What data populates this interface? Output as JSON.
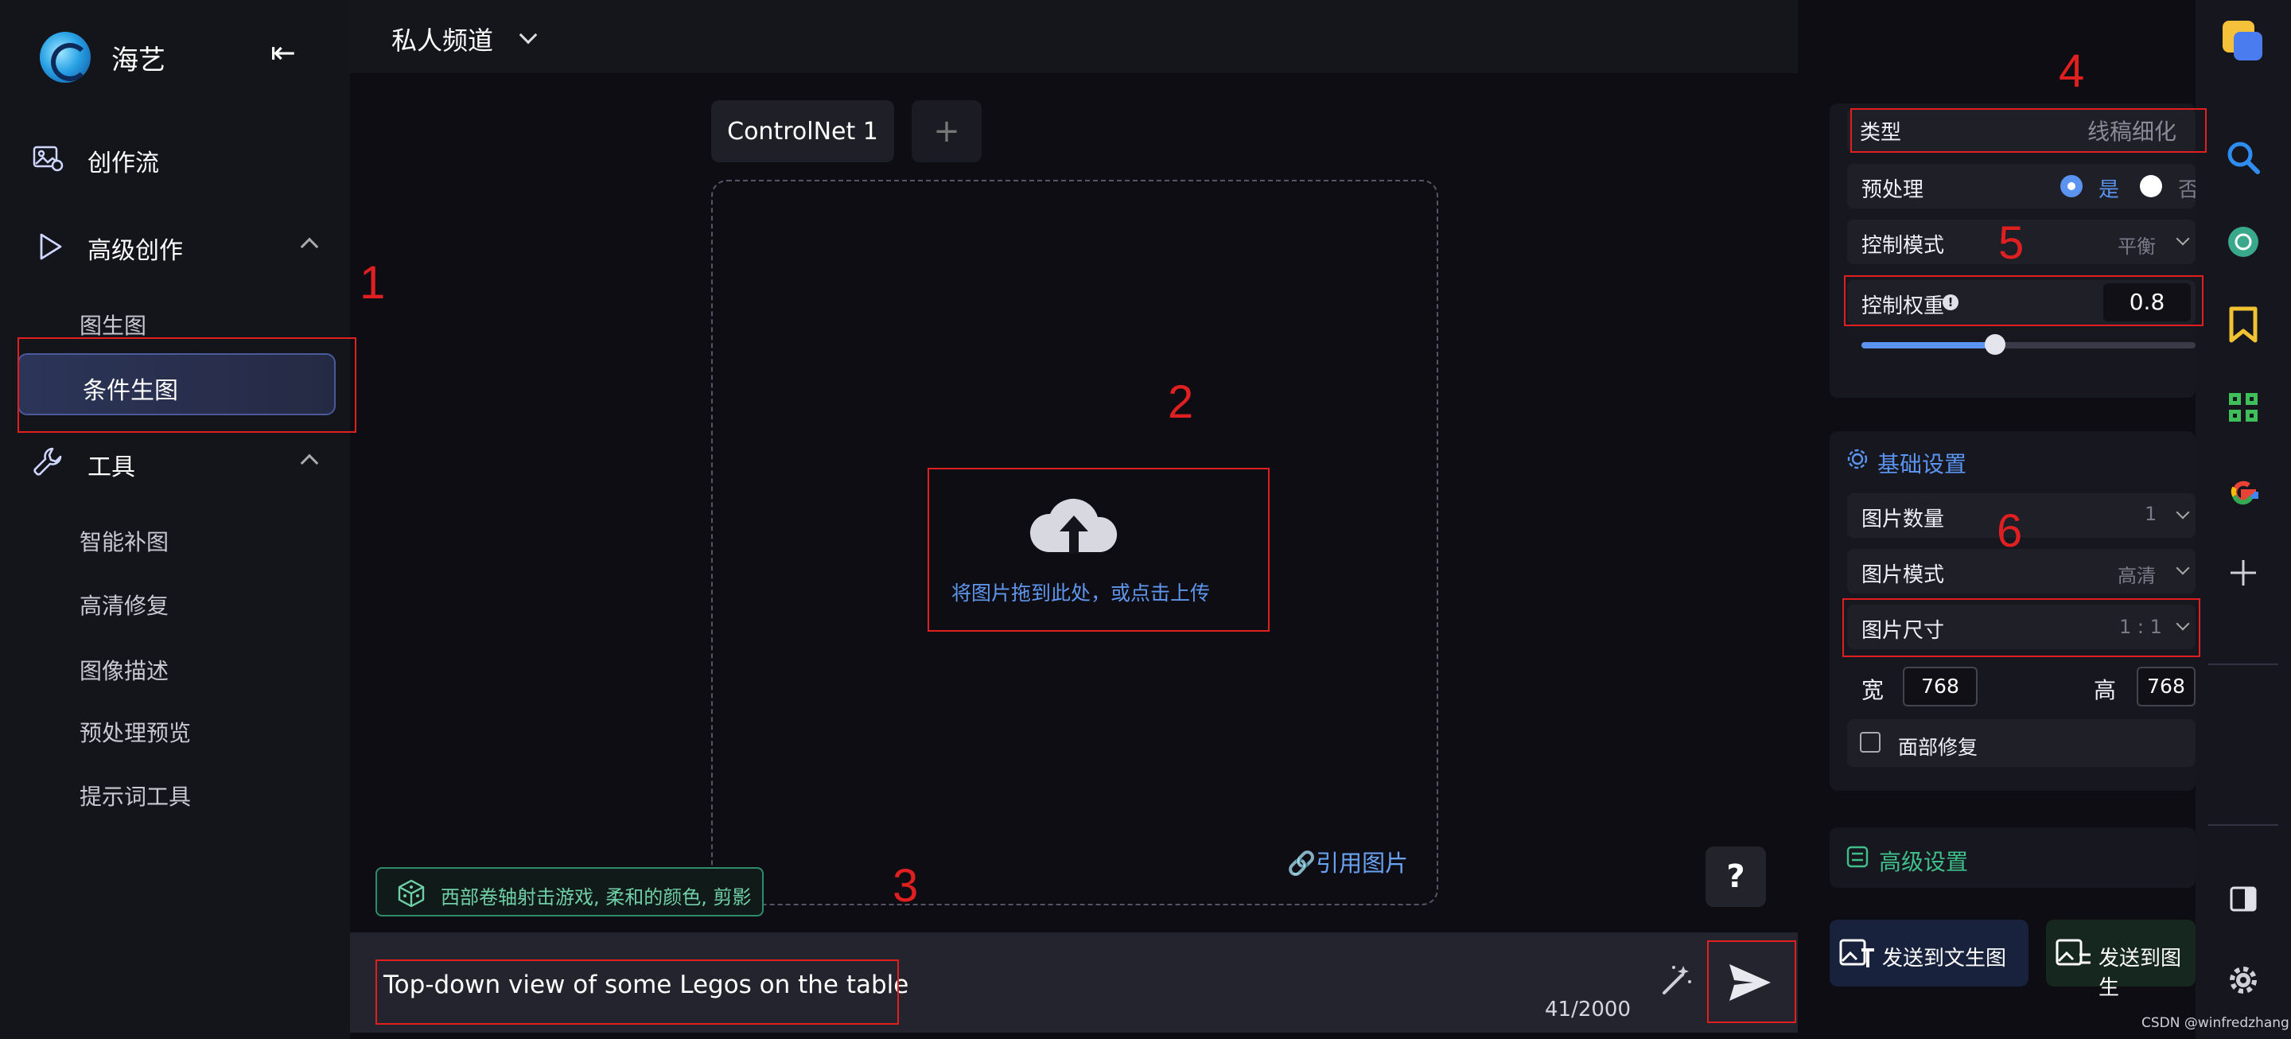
{
  "sidebar": {
    "brand": "海艺",
    "collapse_icon": "collapse-left-icon",
    "sections": [
      {
        "label": "创作流",
        "icon": "image-edit-icon"
      },
      {
        "label": "高级创作",
        "icon": "play-icon",
        "children": [
          "图生图",
          "条件生图"
        ]
      },
      {
        "label": "工具",
        "icon": "wrench-icon",
        "children": [
          "智能补图",
          "高清修复",
          "图像描述",
          "预处理预览",
          "提示词工具"
        ]
      }
    ],
    "active": "条件生图"
  },
  "header": {
    "channel": "私人频道"
  },
  "controlnet": {
    "tab_label": "ControlNet 1",
    "add_tab": "+",
    "upload_text": "将图片拖到此处，或点击上传",
    "ref_image": "引用图片"
  },
  "help": "?",
  "suggestion": "西部卷轴射击游戏, 柔和的颜色, 剪影",
  "prompt": {
    "text": "Top-down view of some Legos on the table",
    "counter": "41/2000"
  },
  "settings": {
    "type_label": "类型",
    "type_value": "线稿细化",
    "preprocess_label": "预处理",
    "preprocess_yes": "是",
    "preprocess_no": "否",
    "control_mode_label": "控制模式",
    "control_mode_value": "平衡",
    "weight_label": "控制权重",
    "weight_value": "0.8",
    "weight_slider": 0.8
  },
  "basic": {
    "title": "基础设置",
    "count_label": "图片数量",
    "count_value": "1",
    "mode_label": "图片模式",
    "mode_value": "高清",
    "size_label": "图片尺寸",
    "size_value": "1 : 1",
    "width_label": "宽",
    "width_value": "768",
    "height_label": "高",
    "height_value": "768",
    "face_fix": "面部修复"
  },
  "advanced": {
    "title": "高级设置"
  },
  "actions": {
    "send_txt2img": "发送到文生图",
    "send_img2img": "发送到图生"
  },
  "annotations": [
    "1",
    "2",
    "3",
    "4",
    "5",
    "6"
  ],
  "watermark": "CSDN @winfredzhang",
  "colors": {
    "accent": "#5b94f0",
    "annotation": "#e02020",
    "green": "#3fbf8a"
  }
}
